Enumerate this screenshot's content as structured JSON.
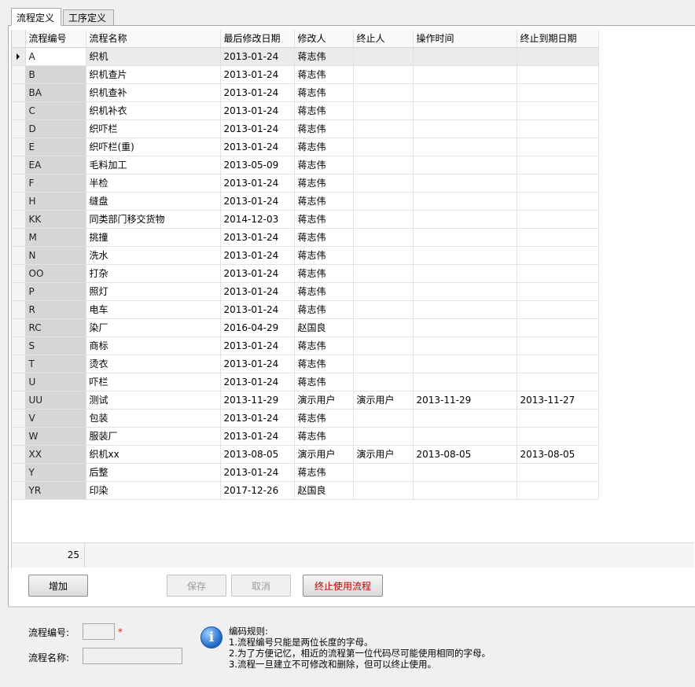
{
  "tabs": [
    {
      "label": "流程定义",
      "active": true
    },
    {
      "label": "工序定义",
      "active": false
    }
  ],
  "grid": {
    "columns": [
      "流程编号",
      "流程名称",
      "最后修改日期",
      "修改人",
      "终止人",
      "操作时间",
      "终止到期日期"
    ],
    "rows": [
      [
        "A",
        "织机",
        "2013-01-24",
        "蒋志伟",
        "",
        "",
        ""
      ],
      [
        "B",
        "织机查片",
        "2013-01-24",
        "蒋志伟",
        "",
        "",
        ""
      ],
      [
        "BA",
        "织机查补",
        "2013-01-24",
        "蒋志伟",
        "",
        "",
        ""
      ],
      [
        "C",
        "织机补衣",
        "2013-01-24",
        "蒋志伟",
        "",
        "",
        ""
      ],
      [
        "D",
        "织吓栏",
        "2013-01-24",
        "蒋志伟",
        "",
        "",
        ""
      ],
      [
        "E",
        "织吓栏(重)",
        "2013-01-24",
        "蒋志伟",
        "",
        "",
        ""
      ],
      [
        "EA",
        "毛料加工",
        "2013-05-09",
        "蒋志伟",
        "",
        "",
        ""
      ],
      [
        "F",
        "半检",
        "2013-01-24",
        "蒋志伟",
        "",
        "",
        ""
      ],
      [
        "H",
        "缝盘",
        "2013-01-24",
        "蒋志伟",
        "",
        "",
        ""
      ],
      [
        "KK",
        "同类部门移交货物",
        "2014-12-03",
        "蒋志伟",
        "",
        "",
        ""
      ],
      [
        "M",
        "挑撞",
        "2013-01-24",
        "蒋志伟",
        "",
        "",
        ""
      ],
      [
        "N",
        "洗水",
        "2013-01-24",
        "蒋志伟",
        "",
        "",
        ""
      ],
      [
        "OO",
        "打杂",
        "2013-01-24",
        "蒋志伟",
        "",
        "",
        ""
      ],
      [
        "P",
        "照灯",
        "2013-01-24",
        "蒋志伟",
        "",
        "",
        ""
      ],
      [
        "R",
        "电车",
        "2013-01-24",
        "蒋志伟",
        "",
        "",
        ""
      ],
      [
        "RC",
        "染厂",
        "2016-04-29",
        "赵国良",
        "",
        "",
        ""
      ],
      [
        "S",
        "商标",
        "2013-01-24",
        "蒋志伟",
        "",
        "",
        ""
      ],
      [
        "T",
        "烫衣",
        "2013-01-24",
        "蒋志伟",
        "",
        "",
        ""
      ],
      [
        "U",
        "吓栏",
        "2013-01-24",
        "蒋志伟",
        "",
        "",
        ""
      ],
      [
        "UU",
        "测试",
        "2013-11-29",
        "演示用户",
        "演示用户",
        "2013-11-29",
        "2013-11-27"
      ],
      [
        "V",
        "包装",
        "2013-01-24",
        "蒋志伟",
        "",
        "",
        ""
      ],
      [
        "W",
        "服装厂",
        "2013-01-24",
        "蒋志伟",
        "",
        "",
        ""
      ],
      [
        "XX",
        "织机xx",
        "2013-08-05",
        "演示用户",
        "演示用户",
        "2013-08-05",
        "2013-08-05"
      ],
      [
        "Y",
        "后整",
        "2013-01-24",
        "蒋志伟",
        "",
        "",
        ""
      ],
      [
        "YR",
        "印染",
        "2017-12-26",
        "赵国良",
        "",
        "",
        ""
      ]
    ],
    "selected_row": 0,
    "row_count": "25"
  },
  "buttons": {
    "add": "增加",
    "save": "保存",
    "cancel": "取消",
    "terminate": "终止使用流程"
  },
  "form": {
    "code_label": "流程编号:",
    "code_value": "",
    "required_mark": "*",
    "name_label": "流程名称:",
    "name_value": ""
  },
  "rules": {
    "title": "编码规则:",
    "lines": [
      "1.流程编号只能是两位长度的字母。",
      "2.为了方便记忆，相近的流程第一位代码尽可能使用相同的字母。",
      "3.流程一旦建立不可修改和删除，但可以终止使用。"
    ]
  },
  "colors": {
    "terminate_text": "#c00000",
    "code_column_bg": "#d6d6d6",
    "required": "#e02020"
  }
}
